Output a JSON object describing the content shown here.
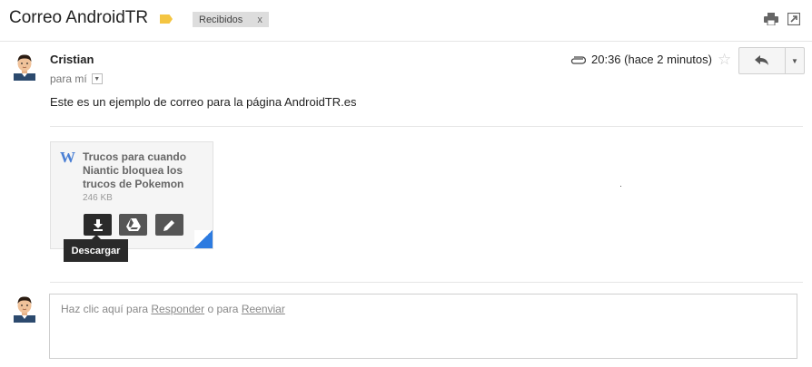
{
  "header": {
    "subject": "Correo AndroidTR",
    "label_chip": "Recibidos",
    "label_chip_close": "x",
    "icons": [
      "print-icon",
      "new-window-icon"
    ]
  },
  "message": {
    "sender": "Cristian",
    "to_label": "para mí",
    "time": "20:36 (hace 2 minutos)",
    "body": "Este es un ejemplo de correo para la página AndroidTR.es"
  },
  "attachment": {
    "type_letter": "W",
    "name": "Trucos para cuando Niantic bloquea los trucos de Pokemon",
    "size": "246 KB",
    "tooltip": "Descargar"
  },
  "reply": {
    "prefix": "Haz clic aquí para ",
    "reply_link": "Responder",
    "middle": " o para ",
    "forward_link": "Reenviar"
  },
  "colors": {
    "label_yellow": "#f4c542",
    "word_blue": "#4a7fd4",
    "fold_blue": "#2d7be0",
    "dark_button": "#2a2a2a"
  }
}
